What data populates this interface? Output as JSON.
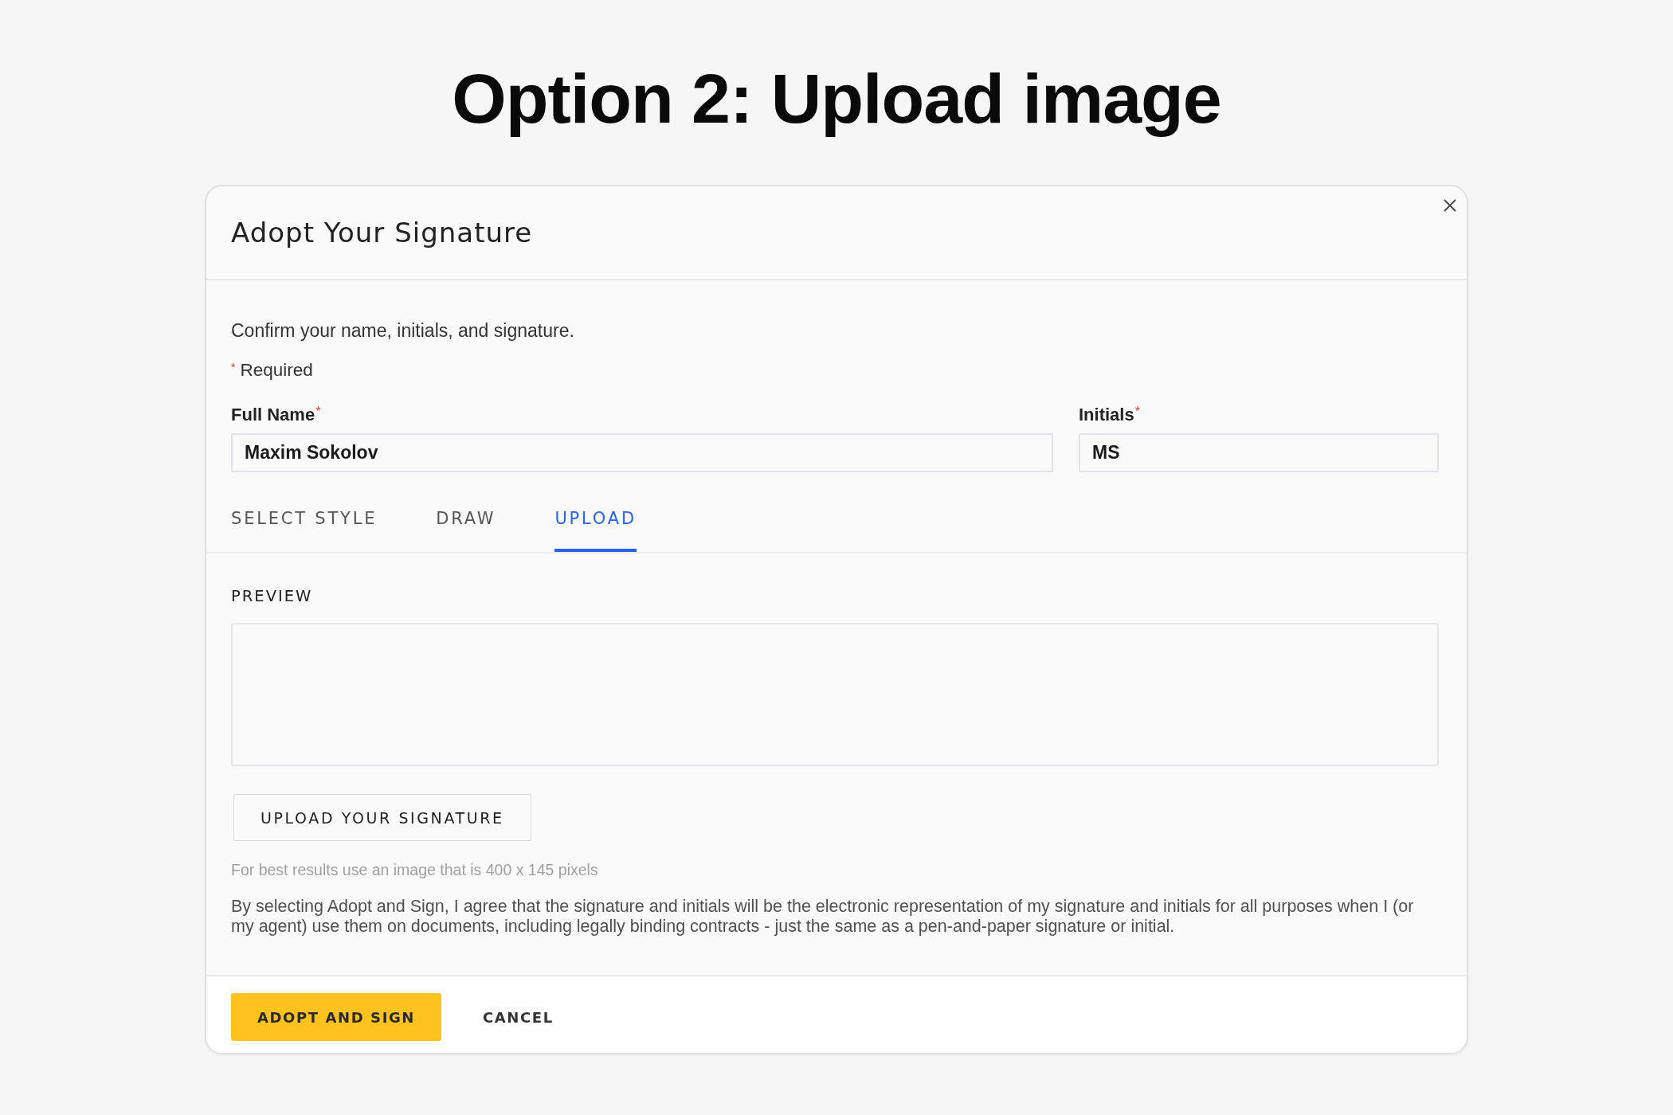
{
  "heading": "Option 2: Upload image",
  "dialog": {
    "title": "Adopt Your Signature",
    "instructions": "Confirm your name, initials, and signature.",
    "required_note": {
      "mark": "*",
      "text": "Required"
    },
    "fields": [
      {
        "label": "Full Name",
        "required_mark": "*",
        "value": "Maxim Sokolov"
      },
      {
        "label": "Initials",
        "required_mark": "*",
        "value": "MS"
      }
    ],
    "tabs": [
      {
        "label": "SELECT STYLE",
        "selected": false
      },
      {
        "label": "DRAW",
        "selected": false
      },
      {
        "label": "UPLOAD",
        "selected": true
      }
    ],
    "preview_label": "PREVIEW",
    "upload_button": "UPLOAD YOUR SIGNATURE",
    "hint": "For best results use an image that is 400 x 145 pixels",
    "disclaimer": "By selecting Adopt and Sign, I agree that the signature and initials will be the electronic representation of my signature and initials for all purposes when I (or my agent) use them on documents, including legally binding contracts - just the same as a pen-and-paper signature or initial.",
    "buttons": [
      {
        "label": "ADOPT AND SIGN",
        "kind": "primary"
      },
      {
        "label": "CANCEL",
        "kind": "secondary"
      }
    ]
  }
}
